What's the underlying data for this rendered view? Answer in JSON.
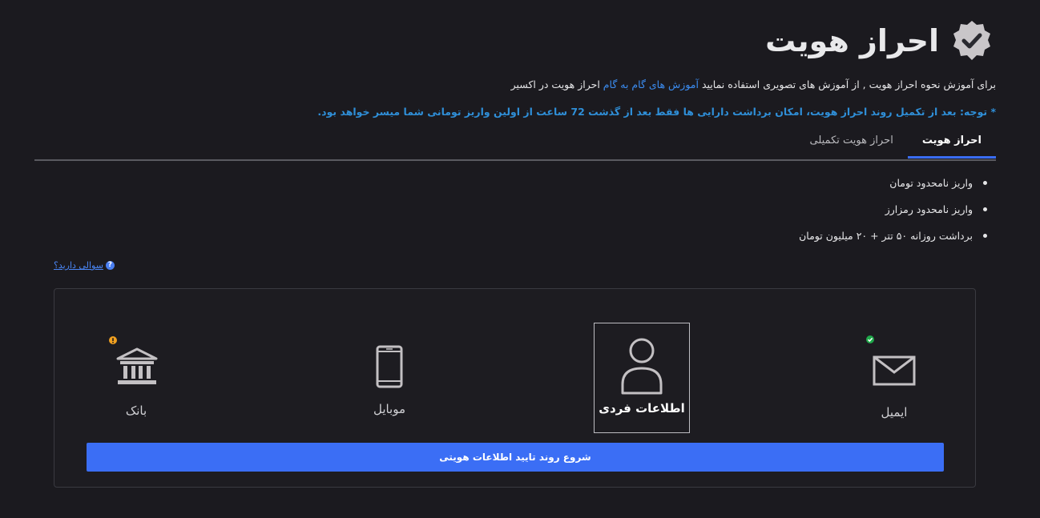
{
  "header": {
    "title": "احراز هویت",
    "badge_icon": "verified-badge-icon"
  },
  "intro": {
    "prefix": "برای آموزش نحوه احراز هویت , از آموزش های تصویری استفاده نمایید ",
    "link": "آموزش های گام به گام",
    "suffix": " احراز هویت در اکسیر"
  },
  "warning": "* توجه: بعد از تکمیل روند احراز هویت، امکان برداشت دارایی ها فقط بعد از گذشت 72 ساعت از اولین واریز تومانی شما میسر خواهد بود.",
  "tabs": [
    {
      "label": "احراز هویت",
      "active": true
    },
    {
      "label": "احراز هویت تکمیلی",
      "active": false
    }
  ],
  "features": [
    "واریز نامحدود تومان",
    "واریز نامحدود رمزارز",
    "برداشت روزانه ۵۰ تتر + ۲۰ میلیون تومان"
  ],
  "question": {
    "label": "سوالی دارید؟",
    "icon": "?"
  },
  "steps": [
    {
      "label": "ایمیل",
      "icon": "envelope-icon",
      "status": "done"
    },
    {
      "label": "اطلاعات فردی",
      "icon": "user-icon",
      "status": "active"
    },
    {
      "label": "موبایل",
      "icon": "mobile-icon",
      "status": "none"
    },
    {
      "label": "بانک",
      "icon": "bank-icon",
      "status": "warning"
    }
  ],
  "start_button": "شروع روند تایید اطلاعات هویتی",
  "colors": {
    "background": "#1b1a1f",
    "accent": "#3b6ef5",
    "link": "#3b8cf0",
    "success": "#1fa84a",
    "warning": "#f0a020"
  }
}
